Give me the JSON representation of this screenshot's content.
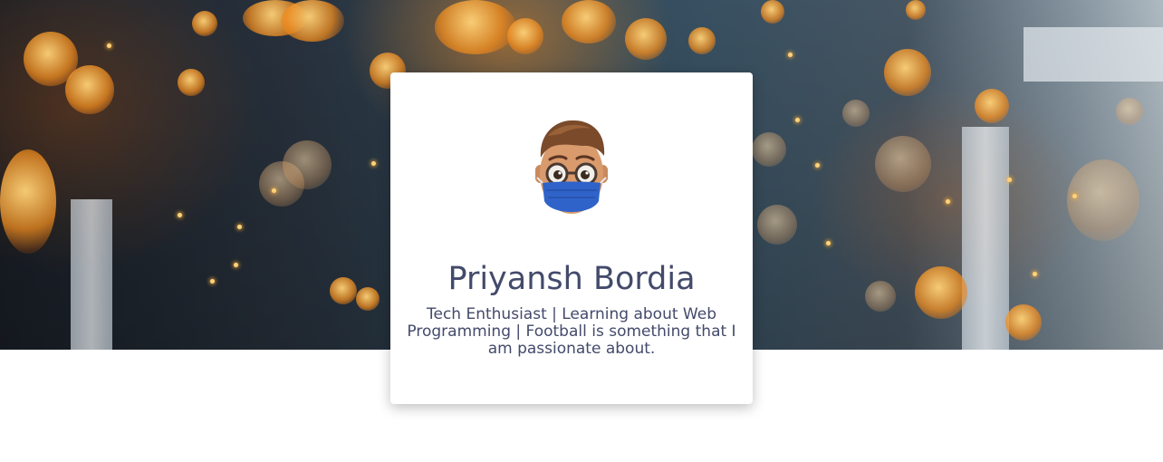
{
  "profile": {
    "name": "Priyansh Bordia",
    "bio": "Tech Enthusiast | Learning about Web Programming | Football is something that I am passionate about.",
    "avatar_icon": "memoji-avatar-with-mask-icon"
  },
  "colors": {
    "text": "#434a6b",
    "card_background": "#ffffff",
    "mask": "#2f63c9"
  }
}
